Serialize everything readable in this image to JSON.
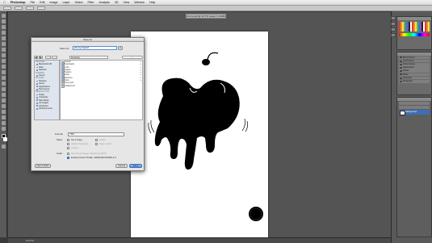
{
  "menubar": {
    "apple": "",
    "items": [
      "Photoshop",
      "File",
      "Edit",
      "Image",
      "Layer",
      "Select",
      "Filter",
      "Analysis",
      "3D",
      "View",
      "Window",
      "Help"
    ]
  },
  "document": {
    "tab_title": "cherry.psd @ 16.7% (Layer 0, RGB/8)"
  },
  "status": {
    "zoom": "16.67%"
  },
  "panels": {
    "tool_presets": [
      "Brush Preset",
      "Tool Presets",
      "Clone Source",
      "Adjustments",
      "Masks",
      "Paths",
      "Character",
      "Paragraph"
    ],
    "layers": {
      "layer_name": "Background"
    }
  },
  "dialog": {
    "title": "Save As",
    "save_as_label": "Save As:",
    "filename": "cherry-final.tif",
    "location": "Desktop",
    "nav_back": "◀",
    "nav_forward": "▶",
    "sidebar": {
      "groups": [
        {
          "label": "DEVICES",
          "items": [
            "Macintosh HD",
            "iDisk",
            "Network"
          ]
        },
        {
          "label": "SHARED",
          "items": [
            "Server"
          ]
        },
        {
          "label": "PLACES",
          "items": [
            "Desktop",
            "Home",
            "Applications",
            "Documents"
          ]
        },
        {
          "label": "SEARCH FOR",
          "items": [
            "Today",
            "Yesterday",
            "Past Week",
            "All Images",
            "All Movies",
            "All Documents"
          ]
        }
      ]
    },
    "files": [
      {
        "name": "Artwork",
        "folder": true
      },
      {
        "name": "Downloads",
        "folder": true
      },
      {
        "name": "Fonts",
        "folder": true
      },
      {
        "name": "Images",
        "folder": true
      },
      {
        "name": "Projects",
        "folder": true
      },
      {
        "name": "Scans",
        "folder": true
      },
      {
        "name": "Sketches",
        "folder": true
      },
      {
        "name": "Stock",
        "folder": true
      },
      {
        "name": "cherry.psd",
        "folder": false
      },
      {
        "name": "Untitled.psd",
        "folder": false
      }
    ],
    "format_label": "Format:",
    "format_value": "TIFF",
    "save_label": "Save:",
    "option_as_copy": "As a Copy",
    "option_notes": "Notes",
    "option_alpha": "Alpha Channels",
    "option_spot": "Spot Colors",
    "option_layers": "Layers",
    "color_label": "Color:",
    "option_proof": "Use Proof Setup:  Working CMYK",
    "option_icc": "Embed Color Profile:  sRGB IEC61966-2.1",
    "new_folder": "New Folder",
    "cancel": "Cancel",
    "save": "Save"
  }
}
